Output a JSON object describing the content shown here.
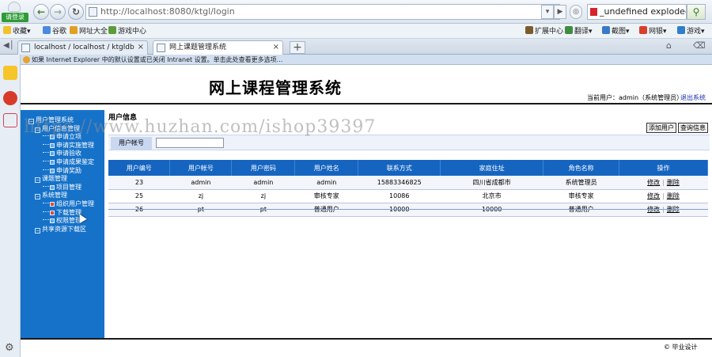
{
  "browser": {
    "login_label": "请登录",
    "url": "http://localhost:8080/ktgl/login",
    "search_text": "_undefined exploded archi",
    "favorites": [
      "收藏",
      "谷歌",
      "网址大全",
      "游戏中心"
    ],
    "right_tools": [
      "扩展中心",
      "翻译",
      "截图",
      "网银",
      "游戏"
    ],
    "tabs": [
      {
        "label": "localhost / localhost / ktgldb",
        "active": false
      },
      {
        "label": "网上课题管理系统",
        "active": true
      }
    ],
    "info_bar": "如果 Internet Explorer 中的默认设置或已关闭 Intranet 设置。单击此处查看更多选项..."
  },
  "page": {
    "title": "网上课程管理系统",
    "current_user": "当前用户：admin（系统管理员）",
    "logout": "退出系统",
    "copyright": "© 毕业设计"
  },
  "sidebar": {
    "items": [
      {
        "label": "用户管理系统",
        "level": 0,
        "kind": "node"
      },
      {
        "label": "用户信息管理",
        "level": 1,
        "kind": "node"
      },
      {
        "label": "申请立项",
        "level": 2,
        "kind": "leaf"
      },
      {
        "label": "申请实施管理",
        "level": 2,
        "kind": "leaf"
      },
      {
        "label": "申请验收",
        "level": 2,
        "kind": "leaf"
      },
      {
        "label": "申请成果鉴定",
        "level": 2,
        "kind": "leaf"
      },
      {
        "label": "申请奖励",
        "level": 2,
        "kind": "leaf"
      },
      {
        "label": "课题管理",
        "level": 1,
        "kind": "node"
      },
      {
        "label": "项目管理",
        "level": 2,
        "kind": "leaf"
      },
      {
        "label": "系统管理",
        "level": 1,
        "kind": "node"
      },
      {
        "label": "组织用户管理",
        "level": 2,
        "kind": "leaf-red"
      },
      {
        "label": "下载管理",
        "level": 2,
        "kind": "leaf-red"
      },
      {
        "label": "权限管理",
        "level": 2,
        "kind": "leaf"
      },
      {
        "label": "共享资源下载区",
        "level": 1,
        "kind": "node"
      }
    ]
  },
  "main": {
    "section_title": "用户信息",
    "add_button": "添加用户",
    "query_button": "查询信息",
    "filter_label": "用户帐号",
    "filter_value": "",
    "columns": [
      "用户编号",
      "用户帐号",
      "用户密码",
      "用户姓名",
      "联系方式",
      "家庭住址",
      "角色名称",
      "操作"
    ],
    "rows": [
      [
        "23",
        "admin",
        "admin",
        "admin",
        "15883346825",
        "四川省成都市",
        "系统管理员"
      ],
      [
        "25",
        "zj",
        "zj",
        "审核专家",
        "10086",
        "北京市",
        "审核专家"
      ],
      [
        "26",
        "pt",
        "pt",
        "普通用户",
        "10000",
        "10000",
        "普通用户"
      ]
    ],
    "edit_label": "修改",
    "delete_label": "删除"
  },
  "watermark": "https://www.huzhan.com/ishop39397"
}
